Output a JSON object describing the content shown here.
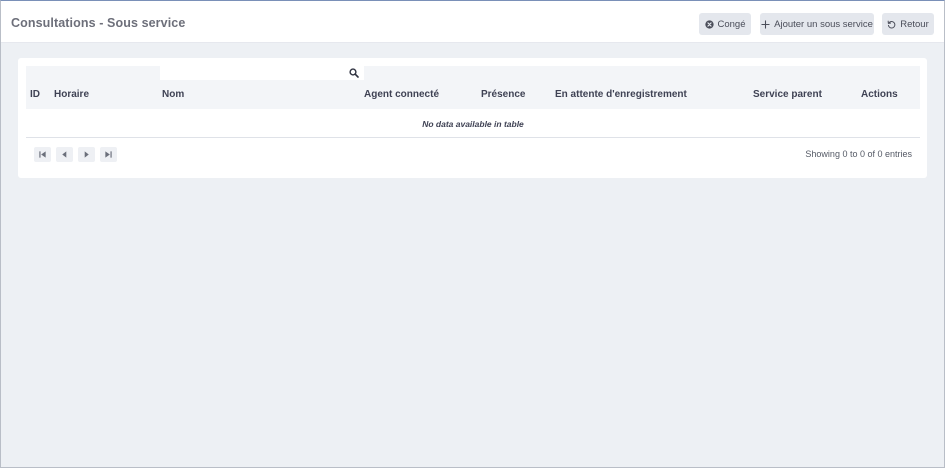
{
  "header": {
    "title": "Consultations - Sous service",
    "buttons": {
      "conge": {
        "label": "Congé",
        "icon": "times-circle-icon"
      },
      "add": {
        "label": "Ajouter un sous service",
        "icon": "plus-icon"
      },
      "retour": {
        "label": "Retour",
        "icon": "undo-icon"
      }
    }
  },
  "table": {
    "search": {
      "value": "",
      "placeholder": ""
    },
    "columns": [
      "ID",
      "Horaire",
      "Nom",
      "Agent connecté",
      "Présence",
      "En attente d'enregistrement",
      "Service parent",
      "Actions"
    ],
    "rows": [],
    "empty_message": "No data available in table",
    "info": "Showing 0 to 0 of 0 entries",
    "pagination_icons": [
      "first-page-icon",
      "previous-page-icon",
      "next-page-icon",
      "last-page-icon"
    ]
  },
  "colors": {
    "background": "#edf0f4",
    "card": "#ffffff",
    "button": "#e4e7ed",
    "header_row": "#f3f5f8",
    "text": "#3f4254"
  }
}
